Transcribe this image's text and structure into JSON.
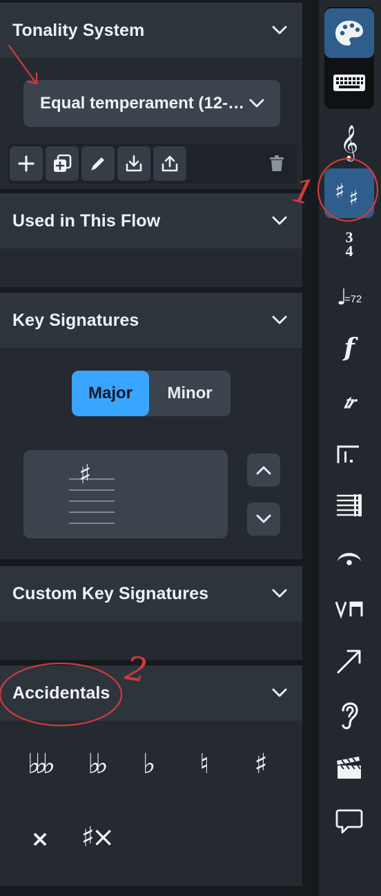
{
  "panels": {
    "tonality": {
      "title": "Tonality System",
      "dropdown_value": "Equal temperament (12-…"
    },
    "used_in_flow": {
      "title": "Used in This Flow"
    },
    "key_signatures": {
      "title": "Key Signatures",
      "mode_options": [
        "Major",
        "Minor"
      ],
      "selected_mode": "Major",
      "preview_glyph": "♯"
    },
    "custom_key_signatures": {
      "title": "Custom Key Signatures"
    },
    "accidentals": {
      "title": "Accidentals",
      "items": [
        "triple-flat",
        "double-flat",
        "flat",
        "natural",
        "sharp",
        "double-sharp",
        "triple-sharp"
      ]
    }
  },
  "toolbar": {
    "buttons": [
      "add-icon",
      "duplicate-icon",
      "edit-icon",
      "import-icon",
      "export-icon",
      "delete-icon"
    ]
  },
  "sidebar": {
    "active_item": "key-signatures",
    "items": [
      "palette",
      "keyboard",
      "clefs",
      "key-signatures",
      "time-signatures",
      "tempo",
      "dynamics",
      "ornaments",
      "repeat-structures",
      "bars",
      "holds-and-pauses",
      "playing-techniques",
      "lines",
      "ear",
      "cues",
      "comments"
    ],
    "tempo_label": "=72",
    "timesig_numerator": "3",
    "timesig_denominator": "4"
  },
  "annotations": {
    "numbers": [
      "1",
      "2"
    ],
    "colors": {
      "annotation": "#d23b3b"
    }
  },
  "colors": {
    "accent": "#3aa5ff",
    "active_sidebar": "#2f5d8c",
    "panel_header": "#2e343c",
    "panel_body": "#252a31"
  }
}
